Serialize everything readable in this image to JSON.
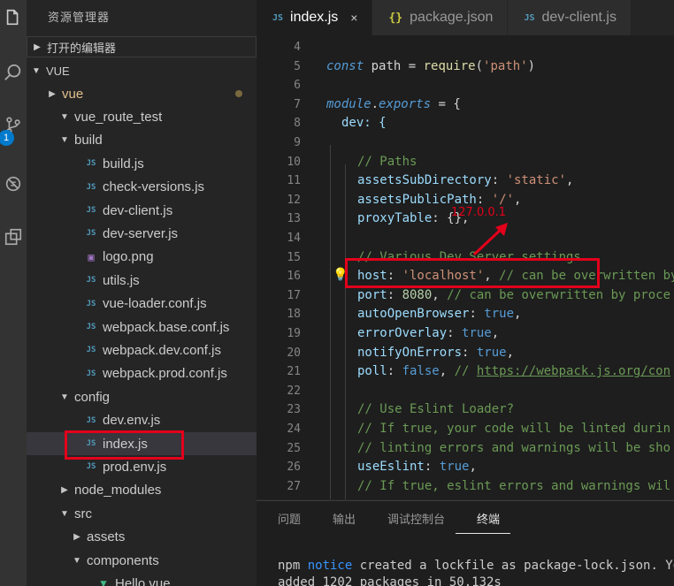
{
  "activity": {
    "badge": "1",
    "icons": [
      "files-icon",
      "search-icon",
      "source-control-icon",
      "debug-icon",
      "extensions-icon"
    ]
  },
  "sidebar": {
    "title": "资源管理器",
    "open_editors": "打开的编辑器",
    "workspace": "VUE",
    "tree": [
      {
        "label": "vue",
        "type": "folder",
        "expanded": false,
        "modified": true
      },
      {
        "label": "vue_route_test",
        "type": "folder",
        "expanded": true
      },
      {
        "label": "build",
        "type": "folder",
        "expanded": true
      },
      {
        "label": "build.js",
        "type": "js"
      },
      {
        "label": "check-versions.js",
        "type": "js"
      },
      {
        "label": "dev-client.js",
        "type": "js"
      },
      {
        "label": "dev-server.js",
        "type": "js"
      },
      {
        "label": "logo.png",
        "type": "png"
      },
      {
        "label": "utils.js",
        "type": "js"
      },
      {
        "label": "vue-loader.conf.js",
        "type": "js"
      },
      {
        "label": "webpack.base.conf.js",
        "type": "js"
      },
      {
        "label": "webpack.dev.conf.js",
        "type": "js"
      },
      {
        "label": "webpack.prod.conf.js",
        "type": "js"
      },
      {
        "label": "config",
        "type": "folder",
        "expanded": true
      },
      {
        "label": "dev.env.js",
        "type": "js"
      },
      {
        "label": "index.js",
        "type": "js",
        "selected": true
      },
      {
        "label": "prod.env.js",
        "type": "js"
      },
      {
        "label": "node_modules",
        "type": "folder",
        "expanded": false
      },
      {
        "label": "src",
        "type": "folder",
        "expanded": true
      },
      {
        "label": "assets",
        "type": "folder",
        "expanded": false
      },
      {
        "label": "components",
        "type": "folder",
        "expanded": true
      },
      {
        "label": "Hello.vue",
        "type": "vue"
      }
    ]
  },
  "tabs": [
    {
      "label": "index.js",
      "icon": "JS",
      "active": true,
      "close": "×"
    },
    {
      "label": "package.json",
      "icon": "{}",
      "active": false
    },
    {
      "label": "dev-client.js",
      "icon": "JS",
      "active": false
    }
  ],
  "editor": {
    "line_numbers": [
      "4",
      "5",
      "6",
      "7",
      "8",
      "9",
      "10",
      "11",
      "12",
      "13",
      "14",
      "15",
      "16",
      "17",
      "18",
      "19",
      "20",
      "21",
      "22",
      "23",
      "24",
      "25",
      "26",
      "27"
    ],
    "lines": {
      "l5": {
        "kw": "const",
        "a": " path = ",
        "fn": "require",
        "b": "(",
        "str": "'path'",
        "c": ")"
      },
      "l7": {
        "kw": "module",
        "a": ".",
        "kw2": "exports",
        "b": " = {"
      },
      "l8": "dev: {",
      "l10": "// Paths",
      "l11": {
        "prop": "assetsSubDirectory",
        "a": ": ",
        "str": "'static'",
        "b": ","
      },
      "l12": {
        "prop": "assetsPublicPath",
        "a": ": ",
        "str": "'/'",
        "b": ","
      },
      "l13": {
        "prop": "proxyTable",
        "a": ": {},"
      },
      "l15": "// Various Dev Server settings",
      "l16": {
        "prop": "host",
        "a": ": ",
        "str": "'localhost'",
        "b": ", ",
        "cm": "// can be overwritten by"
      },
      "l17": {
        "prop": "port",
        "a": ": ",
        "num": "8080",
        "b": ", ",
        "cm": "// can be overwritten by proce"
      },
      "l18": {
        "prop": "autoOpenBrowser",
        "a": ": ",
        "bool": "true",
        "b": ","
      },
      "l19": {
        "prop": "errorOverlay",
        "a": ": ",
        "bool": "true",
        "b": ","
      },
      "l20": {
        "prop": "notifyOnErrors",
        "a": ": ",
        "bool": "true",
        "b": ","
      },
      "l21": {
        "prop": "poll",
        "a": ": ",
        "bool": "false",
        "b": ", ",
        "cm": "// ",
        "link": "https://webpack.js.org/con"
      },
      "l23": "// Use Eslint Loader?",
      "l24": "// If true, your code will be linted durin",
      "l25": "// linting errors and warnings will be sho",
      "l26": {
        "prop": "useEslint",
        "a": ": ",
        "bool": "true",
        "b": ","
      },
      "l27": "// If true, eslint errors and warnings wil"
    },
    "annotation": "127.0.0.1"
  },
  "panel": {
    "tabs": [
      "问题",
      "输出",
      "调试控制台",
      "终端"
    ],
    "active_tab": "终端",
    "terminal": {
      "line1_a": "npm ",
      "line1_notice": "notice",
      "line1_b": " created a lockfile as package-lock.json. You",
      "line2": "added 1202 packages in 50.132s"
    }
  },
  "colors": {
    "accent": "#007acc",
    "highlight": "#e3001b"
  }
}
